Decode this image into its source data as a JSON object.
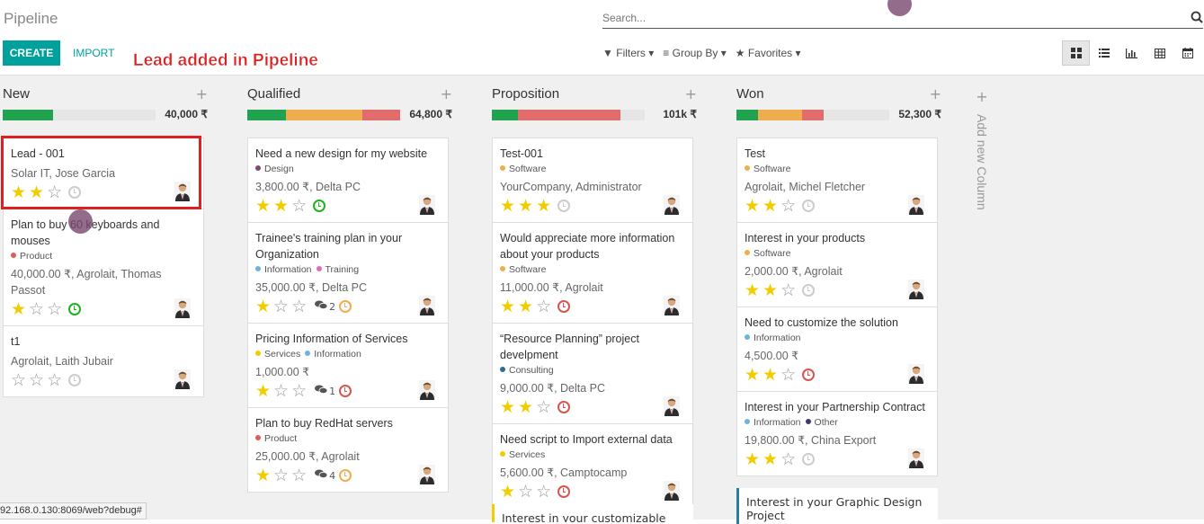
{
  "header": {
    "title": "Pipeline",
    "search_placeholder": "Search...",
    "create_label": "CREATE",
    "import_label": "IMPORT",
    "annotation": "Lead added in Pipeline",
    "filters_label": "Filters",
    "groupby_label": "Group By",
    "favorites_label": "Favorites"
  },
  "columns": [
    {
      "title": "New",
      "total": "40,000 ₹",
      "progress": [
        {
          "color": "#21a24f",
          "fraction": 0.33
        }
      ],
      "cards": [
        {
          "name": "Lead - 001",
          "tags": [],
          "sub": "Solar IT, Jose Garcia",
          "stars": 2,
          "activity": "none",
          "messages": ""
        },
        {
          "name": "Plan to buy 60 keyboards and mouses",
          "tags": [
            {
              "label": "Product",
              "color": "#e05b5b"
            }
          ],
          "sub": "40,000.00 ₹, Agrolait, Thomas Passot",
          "stars": 1,
          "activity": "ok",
          "messages": ""
        },
        {
          "name": "t1",
          "tags": [],
          "sub": "Agrolait, Laith Jubair",
          "stars": 0,
          "activity": "none",
          "messages": ""
        }
      ]
    },
    {
      "title": "Qualified",
      "total": "64,800 ₹",
      "progress": [
        {
          "color": "#21a24f",
          "fraction": 0.25
        },
        {
          "color": "#f0ad4e",
          "fraction": 0.5
        },
        {
          "color": "#e06c6c",
          "fraction": 0.25
        }
      ],
      "cards": [
        {
          "name": "Need a new design for my website",
          "tags": [
            {
              "label": "Design",
              "color": "#7c4a72"
            }
          ],
          "sub": "3,800.00 ₹, Delta PC",
          "stars": 2,
          "activity": "ok",
          "messages": ""
        },
        {
          "name": "Trainee's training plan in your Organization",
          "tags": [
            {
              "label": "Information",
              "color": "#6cb3e0"
            },
            {
              "label": "Training",
              "color": "#e06cb3"
            }
          ],
          "sub": "35,000.00 ₹, Delta PC",
          "stars": 1,
          "activity": "due",
          "messages": "2"
        },
        {
          "name": "Pricing Information of Services",
          "tags": [
            {
              "label": "Services",
              "color": "#f3cc00"
            },
            {
              "label": "Information",
              "color": "#6cb3e0"
            }
          ],
          "sub": "1,000.00 ₹",
          "stars": 1,
          "activity": "late",
          "messages": "1"
        },
        {
          "name": "Plan to buy RedHat servers",
          "tags": [
            {
              "label": "Product",
              "color": "#e05b5b"
            }
          ],
          "sub": "25,000.00 ₹, Agrolait",
          "stars": 1,
          "activity": "due",
          "messages": "4"
        }
      ]
    },
    {
      "title": "Proposition",
      "total": "101k ₹",
      "progress": [
        {
          "color": "#21a24f",
          "fraction": 0.17
        },
        {
          "color": "#e06c6c",
          "fraction": 0.67
        }
      ],
      "cards": [
        {
          "name": "Test-001",
          "tags": [
            {
              "label": "Software",
              "color": "#f0ad4e"
            }
          ],
          "sub": "YourCompany, Administrator",
          "stars": 3,
          "activity": "none",
          "messages": ""
        },
        {
          "name": "Would appreciate more information about your products",
          "tags": [
            {
              "label": "Software",
              "color": "#f0ad4e"
            }
          ],
          "sub": "11,000.00 ₹, Agrolait",
          "stars": 2,
          "activity": "late",
          "messages": ""
        },
        {
          "name": "“Resource Planning” project develpment",
          "tags": [
            {
              "label": "Consulting",
              "color": "#2a6f8e"
            }
          ],
          "sub": "9,000.00 ₹, Delta PC",
          "stars": 2,
          "activity": "late",
          "messages": ""
        },
        {
          "name": "Need script to Import external data",
          "tags": [
            {
              "label": "Services",
              "color": "#f3cc00"
            }
          ],
          "sub": "5,600.00 ₹, Camptocamp",
          "stars": 1,
          "activity": "late",
          "messages": ""
        }
      ],
      "partial_card": "Interest in your customizable Pro..."
    },
    {
      "title": "Won",
      "total": "52,300 ₹",
      "progress": [
        {
          "color": "#21a24f",
          "fraction": 0.14
        },
        {
          "color": "#f0ad4e",
          "fraction": 0.29
        },
        {
          "color": "#e06c6c",
          "fraction": 0.14
        }
      ],
      "cards": [
        {
          "name": "Test",
          "tags": [
            {
              "label": "Software",
              "color": "#f0ad4e"
            }
          ],
          "sub": "Agrolait, Michel Fletcher",
          "stars": 2,
          "activity": "none",
          "messages": ""
        },
        {
          "name": "Interest in your products",
          "tags": [
            {
              "label": "Software",
              "color": "#f0ad4e"
            }
          ],
          "sub": "2,000.00 ₹, Agrolait",
          "stars": 2,
          "activity": "none",
          "messages": ""
        },
        {
          "name": "Need to customize the solution",
          "tags": [
            {
              "label": "Information",
              "color": "#6cb3e0"
            }
          ],
          "sub": "4,500.00 ₹",
          "stars": 2,
          "activity": "late",
          "messages": ""
        },
        {
          "name": "Interest in your Partnership Contract",
          "tags": [
            {
              "label": "Information",
              "color": "#6cb3e0"
            },
            {
              "label": "Other",
              "color": "#3c3c6c"
            }
          ],
          "sub": "19,800.00 ₹, China Export",
          "stars": 2,
          "activity": "none",
          "messages": ""
        }
      ],
      "partial_card": "Interest in your Graphic Design Project"
    }
  ],
  "add_column_label": "Add new Column",
  "status_url": "92.168.0.130:8069/web?debug#"
}
